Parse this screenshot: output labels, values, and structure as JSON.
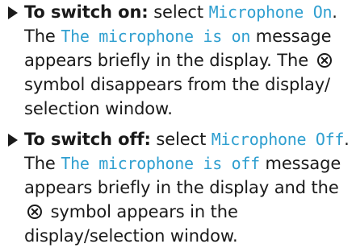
{
  "steps": [
    {
      "label": "To switch on:",
      "select_word": "select",
      "option": "Microphone On",
      "message": "The microphone is on",
      "text_a": "The",
      "text_b": "message appears briefly in the display. The",
      "text_c": "symbol disappears from the display/ selection window."
    },
    {
      "label": "To switch off:",
      "select_word": "select",
      "option": "Microphone Off",
      "message": "The microphone is off",
      "text_a": "The",
      "text_b": "message appears briefly in the display and the",
      "text_c": "symbol appears in the display/selection window."
    }
  ],
  "icon": "microphone-off-icon"
}
